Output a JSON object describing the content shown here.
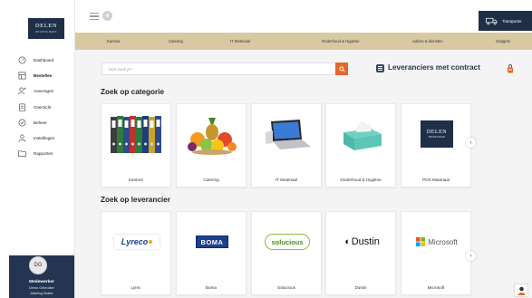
{
  "brand": {
    "logo_line1": "DELEN",
    "logo_line2": "PRIVATE BANK"
  },
  "sidebar": {
    "items": [
      {
        "label": "Dashboard",
        "icon": "dashboard-icon"
      },
      {
        "label": "Bestellen",
        "icon": "order-icon",
        "active": true
      },
      {
        "label": "Aanvragen",
        "icon": "requests-icon"
      },
      {
        "label": "Overzicht",
        "icon": "overview-icon"
      },
      {
        "label": "Beheer",
        "icon": "manage-icon"
      },
      {
        "label": "Instellingen",
        "icon": "settings-icon"
      },
      {
        "label": "Rapporten",
        "icon": "folder-icon"
      }
    ]
  },
  "user": {
    "initials": "DG",
    "role": "Medewerker",
    "name": "Demo Gebruiker",
    "department": "Afdeling Bakke"
  },
  "topbar": {
    "transport_label": "Transporter"
  },
  "categories_bar": [
    "Kantoor",
    "Catering",
    "IT Materiaal",
    "Onderhoud & Hygiëne",
    "Advies & diensten",
    "Gadgets"
  ],
  "search": {
    "placeholder": "Wat zoek je?"
  },
  "contract": {
    "label": "Leveranciers met contract"
  },
  "sections": {
    "category_title": "Zoek op categorie",
    "supplier_title": "Zoek op leverancier"
  },
  "category_cards": [
    {
      "label": "Kantoor",
      "image": "binders"
    },
    {
      "label": "Catering",
      "image": "fruit"
    },
    {
      "label": "IT Materiaal",
      "image": "laptop"
    },
    {
      "label": "Onderhoud & Hygiëne",
      "image": "tissues"
    },
    {
      "label": "POS Materiaal",
      "image": "delen-logo"
    }
  ],
  "supplier_cards": [
    {
      "label": "Lyrec",
      "logo_text": "Lyreco"
    },
    {
      "label": "Boma",
      "logo_text": "BOMA"
    },
    {
      "label": "Solucious",
      "logo_text": "solucious"
    },
    {
      "label": "Dustin",
      "logo_text": "Dustin"
    },
    {
      "label": "Microsoft",
      "logo_text": "Microsoft"
    }
  ],
  "colors": {
    "navy": "#1f2f48",
    "beige": "#d9c9a3",
    "accent": "#e26a2c"
  }
}
